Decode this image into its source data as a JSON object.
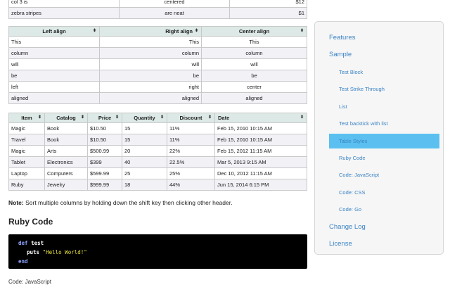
{
  "table_top": {
    "rows": [
      {
        "c1": "col 3 is",
        "c2": "centered",
        "c3": "$12"
      },
      {
        "c1": "zebra stripes",
        "c2": "are neat",
        "c3": "$1"
      }
    ]
  },
  "table_align": {
    "headers": [
      "Left align",
      "Right align",
      "Center align"
    ],
    "sort_icon": "⬍",
    "rows": [
      [
        "This",
        "This",
        "This"
      ],
      [
        "column",
        "column",
        "column"
      ],
      [
        "will",
        "will",
        "will"
      ],
      [
        "be",
        "be",
        "be"
      ],
      [
        "left",
        "right",
        "center"
      ],
      [
        "aligned",
        "aligned",
        "aligned"
      ]
    ]
  },
  "table_items": {
    "headers": [
      "Item",
      "Catalog",
      "Price",
      "Quantity",
      "Discount",
      "Date"
    ],
    "rows": [
      [
        "Magic",
        "Book",
        "$10.50",
        "15",
        "11%",
        "Feb 15, 2010 10:15 AM"
      ],
      [
        "Travel",
        "Book",
        "$10.50",
        "15",
        "11%",
        "Feb 15, 2010 10:15 AM"
      ],
      [
        "Magic",
        "Arts",
        "$500.99",
        "20",
        "22%",
        "Feb 15, 2012 11:15 AM"
      ],
      [
        "Tablet",
        "Electronics",
        "$399",
        "40",
        "22.5%",
        "Mar 5, 2013 9:15 AM"
      ],
      [
        "Laptop",
        "Computers",
        "$599.99",
        "25",
        "25%",
        "Dec 10, 2012 11:15 AM"
      ],
      [
        "Ruby",
        "Jewelry",
        "$999.99",
        "18",
        "44%",
        "Jun 15, 2014 6:15 PM"
      ]
    ]
  },
  "note": {
    "label": "Note:",
    "text": " Sort multiple columns by holding down the shift key then clicking other header."
  },
  "section_title": "Ruby Code",
  "code": {
    "line1_kw": "def",
    "line1_fn": "test",
    "line2_fn": "puts",
    "line2_str": "\"Hello World!\"",
    "line3_kw": "end"
  },
  "cut_text": "Code: JavaScript",
  "sidebar": {
    "features": "Features",
    "sample": "Sample",
    "items": [
      "Test Block",
      "Test Strike Through",
      "List",
      "Test backtick with list",
      "Table Styles",
      "Ruby Code",
      "Code: JavaScript",
      "Code: CSS",
      "Code: Go"
    ],
    "change_log": "Change Log",
    "license": "License",
    "active_color": "#5bc0f0",
    "link_color": "#3a83c4"
  }
}
